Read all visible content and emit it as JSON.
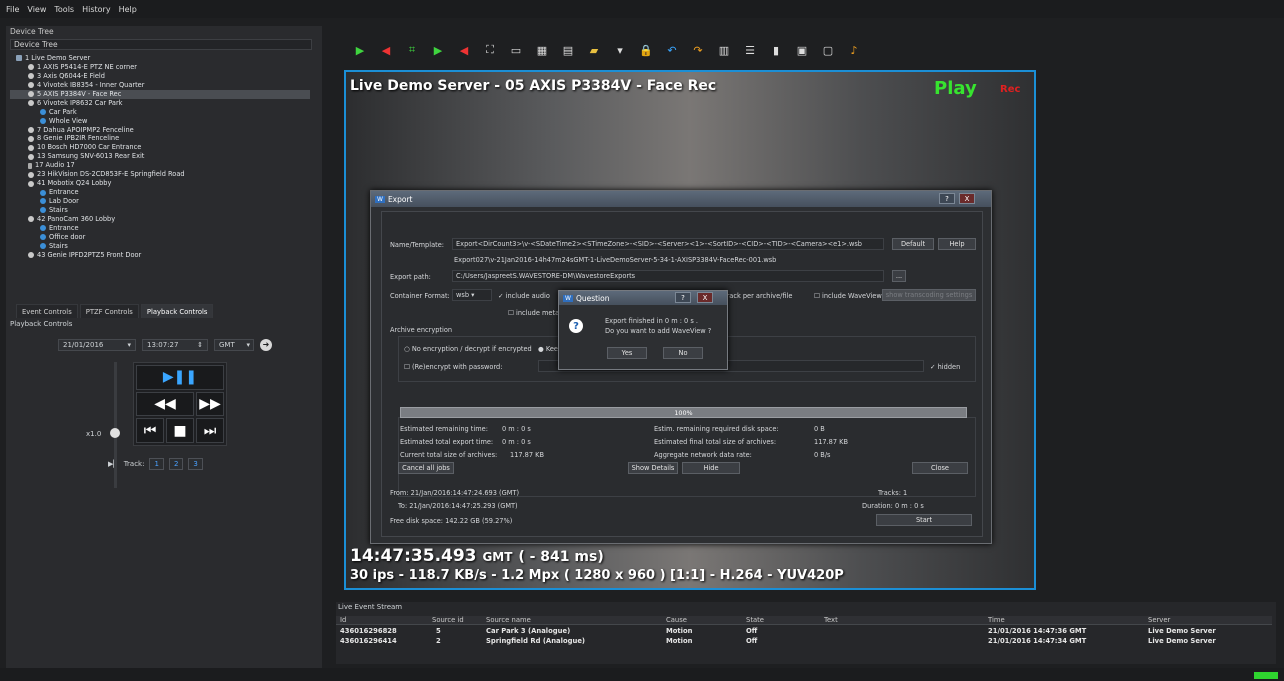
{
  "menu": [
    "File",
    "View",
    "Tools",
    "History",
    "Help"
  ],
  "device_tree": {
    "panel_title": "Device Tree",
    "combo_value": "Device Tree",
    "items": [
      {
        "label": "1 Live Demo Server",
        "icon": "server-icon",
        "level": 0
      },
      {
        "label": "1 AXIS P5414-E PTZ NE corner",
        "icon": "camera-icon",
        "level": 1
      },
      {
        "label": "3 Axis Q6044-E Field",
        "icon": "camera-icon",
        "level": 1
      },
      {
        "label": "4 Vivotek IB8354 - Inner Quarter",
        "icon": "camera-icon",
        "level": 1
      },
      {
        "label": "5 AXIS P3384V - Face Rec",
        "icon": "camera-icon",
        "level": 1,
        "selected": true
      },
      {
        "label": "6 Vivotek IP8632 Car Park",
        "icon": "camera-icon",
        "level": 1
      },
      {
        "label": "Car Park",
        "icon": "view-icon",
        "level": 2
      },
      {
        "label": "Whole View",
        "icon": "view-icon",
        "level": 2
      },
      {
        "label": "7 Dahua APOIPMP2 Fenceline",
        "icon": "camera-icon",
        "level": 1
      },
      {
        "label": "8 Genie IPB2IR Fenceline",
        "icon": "camera-icon",
        "level": 1
      },
      {
        "label": "10 Bosch HD7000 Car Entrance",
        "icon": "camera-icon",
        "level": 1
      },
      {
        "label": "13 Samsung SNV-6013 Rear Exit",
        "icon": "camera-icon",
        "level": 1
      },
      {
        "label": "17 Audio 17",
        "icon": "audio-icon",
        "level": 1
      },
      {
        "label": "23 HikVision DS-2CD853F-E Springfield Road",
        "icon": "camera-icon",
        "level": 1
      },
      {
        "label": "41 Mobotix Q24 Lobby",
        "icon": "camera-icon",
        "level": 1
      },
      {
        "label": "Entrance",
        "icon": "view-icon",
        "level": 2
      },
      {
        "label": "Lab Door",
        "icon": "view-icon",
        "level": 2
      },
      {
        "label": "Stairs",
        "icon": "view-icon",
        "level": 2
      },
      {
        "label": "42 PanoCam 360 Lobby",
        "icon": "camera-icon",
        "level": 1
      },
      {
        "label": "Entrance",
        "icon": "view-icon",
        "level": 2
      },
      {
        "label": "Office door",
        "icon": "view-icon",
        "level": 2
      },
      {
        "label": "Stairs",
        "icon": "view-icon",
        "level": 2
      },
      {
        "label": "43 Genie IPFD2PTZ5 Front Door",
        "icon": "camera-icon",
        "level": 1
      }
    ]
  },
  "tabs": [
    "Event Controls",
    "PTZF Controls",
    "Playback Controls"
  ],
  "playback": {
    "title": "Playback Controls",
    "date": "21/01/2016",
    "time": "13:07:27",
    "tz": "GMT",
    "speed": "x1.0",
    "track_label": "Track:",
    "tracks": [
      "1",
      "2",
      "3"
    ]
  },
  "toolbar_icons": [
    "play-forward-icon",
    "play-back-icon",
    "fence-icon",
    "step-forward-icon",
    "step-back-icon",
    "fullscreen-icon",
    "monitor-icon",
    "grid-icon",
    "snapshot-icon",
    "folder-icon",
    "dropdown-icon",
    "lock-icon",
    "undo-icon",
    "redo-icon",
    "layout-icon",
    "list-icon",
    "equalizer-icon",
    "panel-icon",
    "chat-icon",
    "mic-icon"
  ],
  "video": {
    "title": "Live Demo Server - 05 AXIS P3384V - Face Rec",
    "play": "Play",
    "rec": "Rec",
    "time": "14:47:35.493",
    "time_tz": "GMT",
    "time_offset": "( - 841 ms)",
    "stats": "30 ips  -  118.7 KB/s  -  1.2 Mpx  ( 1280 x 960 ) [1:1] -  H.264  -  YUV420P"
  },
  "export": {
    "title": "Export",
    "name_label": "Name/Template:",
    "name_value": "Export<DirCount3>\\v-<SDateTime2><STimeZone>-<SID>-<Server><1>-<SortID>-<CID>-<TID>-<Camera><e1>.wsb",
    "default_btn": "Default",
    "help_btn": "Help",
    "preview": "Export027\\v-21Jan2016-14h47m24sGMT-1-LiveDemoServer-5-34-1-AXISP3384V-FaceRec-001.wsb",
    "path_label": "Export path:",
    "path_value": "C:/Users/JaspreetS.WAVESTORE-DM\\WavestoreExports",
    "browse_btn": "...",
    "format_label": "Container Format:",
    "format_value": "wsb",
    "include_audio": "include audio",
    "include_metadata": "include metadata",
    "track_per_file": "track per archive/file",
    "include_waveview": "include WaveView",
    "transcoding_btn": "show transcoding settings",
    "encryption_title": "Archive encryption",
    "no_encryption": "No encryption / decrypt if encrypted",
    "keep": "Kee",
    "reencrypt": "(Re)encrypt with password:",
    "hidden": "hidden",
    "progress": "100%",
    "est_remaining_label": "Estimated remaining time:",
    "est_remaining": "0 m : 0 s",
    "est_total_label": "Estimated total export time:",
    "est_total": "0 m : 0 s",
    "current_size_label": "Current total size of archives:",
    "current_size": "117.87 KB",
    "req_disk_label": "Estim. remaining required disk space:",
    "req_disk": "0 B",
    "final_size_label": "Estimated final total size of archives:",
    "final_size": "117.87 KB",
    "rate_label": "Aggregate network data rate:",
    "rate": "0 B/s",
    "cancel_jobs": "Cancel all jobs",
    "show_details": "Show Details",
    "hide": "Hide",
    "close": "Close",
    "from": "From:  21/Jan/2016:14:47:24.693 (GMT)",
    "to": "To:  21/Jan/2016:14:47:25.293 (GMT)",
    "free_disk": "Free disk space:  142.22 GB (59.27%)",
    "tracks": "Tracks:  1",
    "duration": "Duration:  0 m : 0 s",
    "start": "Start",
    "help_q": "?",
    "close_x": "X"
  },
  "question": {
    "title": "Question",
    "line1": "Export finished in 0 m : 0 s .",
    "line2": "Do you want to add WaveView ?",
    "yes": "Yes",
    "no": "No",
    "help_q": "?",
    "close_x": "X"
  },
  "events": {
    "title": "Live Event Stream",
    "columns": [
      "Id",
      "Source id",
      "Source name",
      "Cause",
      "State",
      "Text",
      "Time",
      "Server"
    ],
    "rows": [
      [
        "436016296828",
        "5",
        "Car Park 3 (Analogue)",
        "Motion",
        "Off",
        "",
        "21/01/2016 14:47:36 GMT",
        "Live Demo Server"
      ],
      [
        "436016296414",
        "2",
        "Springfield Rd (Analogue)",
        "Motion",
        "Off",
        "",
        "21/01/2016 14:47:34 GMT",
        "Live Demo Server"
      ]
    ]
  },
  "colors": {
    "accent": "#1b8fd6",
    "play": "#37e42f",
    "rec": "#e02020",
    "status": "#2fd42f"
  }
}
